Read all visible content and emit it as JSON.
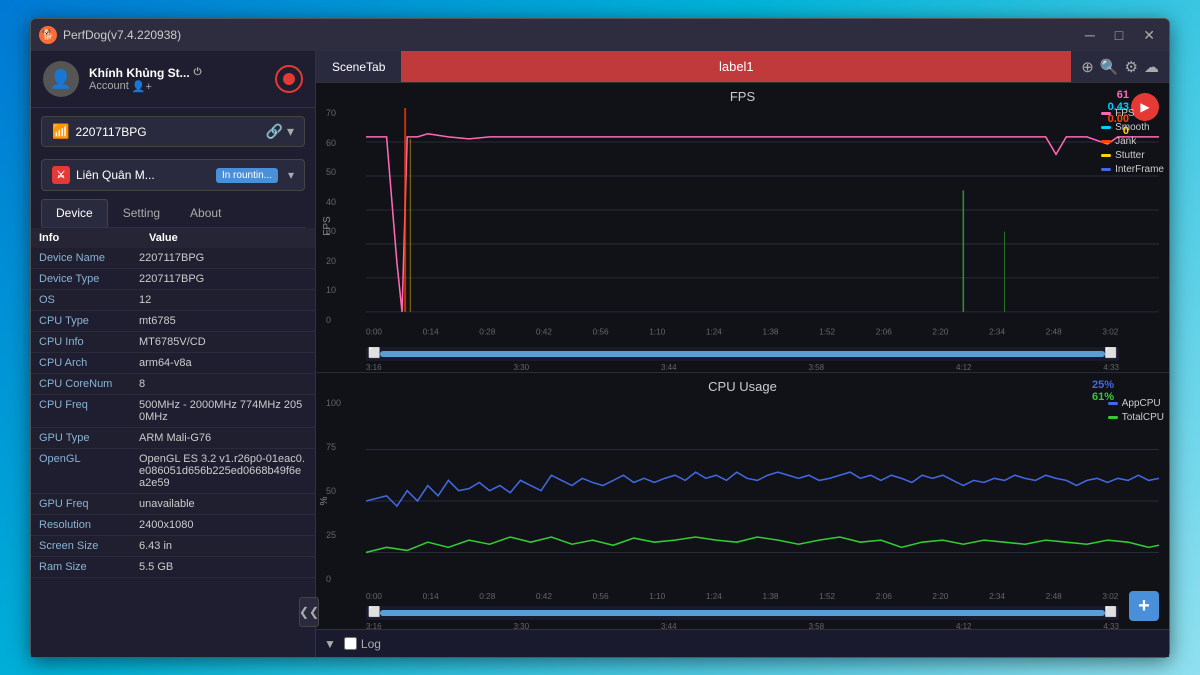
{
  "window": {
    "title": "PerfDog(v7.4.220938)",
    "controls": {
      "minimize": "─",
      "maximize": "□",
      "close": "✕"
    }
  },
  "sidebar": {
    "user": {
      "name": "Khính Khủng St...",
      "account_label": "Account",
      "power_icon": "⏻",
      "add_icon": "👤+"
    },
    "device": {
      "name": "2207117BPG",
      "link_icon": "🔗",
      "chevron": "▾"
    },
    "app": {
      "name": "Liên Quân M...",
      "badge": "In rountin...",
      "chevron": "▾"
    },
    "tabs": [
      {
        "label": "Device",
        "active": true
      },
      {
        "label": "Setting",
        "active": false
      },
      {
        "label": "About",
        "active": false
      }
    ],
    "table_headers": [
      "Info",
      "Value"
    ],
    "table_rows": [
      {
        "key": "Device Name",
        "value": "2207117BPG"
      },
      {
        "key": "Device Type",
        "value": "2207117BPG"
      },
      {
        "key": "OS",
        "value": "12"
      },
      {
        "key": "CPU Type",
        "value": "mt6785"
      },
      {
        "key": "CPU Info",
        "value": "MT6785V/CD"
      },
      {
        "key": "CPU Arch",
        "value": "arm64-v8a"
      },
      {
        "key": "CPU CoreNum",
        "value": "8"
      },
      {
        "key": "CPU Freq",
        "value": "500MHz - 2000MHz 774MHz 2050MHz"
      },
      {
        "key": "GPU Type",
        "value": "ARM Mali-G76"
      },
      {
        "key": "OpenGL",
        "value": "OpenGL ES 3.2 v1.r26p0-01eac0.e086051d656b225ed0668b49f6ea2e59"
      },
      {
        "key": "GPU Freq",
        "value": "unavailable"
      },
      {
        "key": "Resolution",
        "value": "2400x1080"
      },
      {
        "key": "Screen Size",
        "value": "6.43 in"
      },
      {
        "key": "Ram Size",
        "value": "5.5 GB"
      }
    ],
    "collapse_icon": "❮"
  },
  "scene_bar": {
    "tab_label": "SceneTab",
    "label": "label1",
    "icons": [
      "⊕",
      "🔍",
      "⚙",
      "☁"
    ]
  },
  "fps_chart": {
    "title": "FPS",
    "y_axis_label": "FPS",
    "y_ticks": [
      0,
      10,
      20,
      30,
      40,
      50,
      60,
      70
    ],
    "x_ticks": [
      "0:00",
      "0:14",
      "0:28",
      "0:42",
      "0:56",
      "1:10",
      "1:24",
      "1:38",
      "1:52",
      "2:06",
      "2:20",
      "2:34",
      "2:48",
      "3:02",
      "3:16",
      "3:30",
      "3:44",
      "3:58",
      "4:12",
      "4:33"
    ],
    "stats": [
      {
        "value": "61",
        "color": "#ff69b4"
      },
      {
        "value": "0.43",
        "color": "#00cfff"
      },
      {
        "value": "0.00",
        "color": "#ff4500"
      },
      {
        "value": "0",
        "color": "#ffd700"
      }
    ],
    "legend": [
      {
        "label": "FPS",
        "color": "#ff69b4"
      },
      {
        "label": "Smooth",
        "color": "#00cfff"
      },
      {
        "label": "Jank",
        "color": "#ff4500"
      },
      {
        "label": "Stutter",
        "color": "#ffd700"
      },
      {
        "label": "InterFrame",
        "color": "#4169e1"
      }
    ]
  },
  "cpu_chart": {
    "title": "CPU Usage",
    "y_axis_label": "%",
    "y_ticks": [
      0,
      25,
      50,
      75,
      100
    ],
    "x_ticks": [
      "0:00",
      "0:14",
      "0:28",
      "0:42",
      "0:56",
      "1:10",
      "1:24",
      "1:38",
      "1:52",
      "2:06",
      "2:20",
      "2:34",
      "2:48",
      "3:02",
      "3:16",
      "3:30",
      "3:44",
      "3:58",
      "4:12",
      "4:33"
    ],
    "stats": [
      {
        "value": "25%",
        "color": "#4169e1"
      },
      {
        "value": "61%",
        "color": "#32cd32"
      }
    ],
    "legend": [
      {
        "label": "AppCPU",
        "color": "#4169e1"
      },
      {
        "label": "TotalCPU",
        "color": "#32cd32"
      }
    ]
  },
  "bottom_bar": {
    "down_icon": "▼",
    "log_label": "Log"
  },
  "add_btn_label": "+"
}
